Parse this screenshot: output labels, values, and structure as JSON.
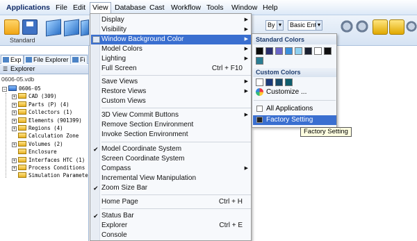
{
  "menubar": {
    "items": [
      "Applications",
      "File",
      "Edit",
      "View",
      "Database",
      "Cast",
      "Workflow",
      "Tools",
      "Window",
      "Help"
    ]
  },
  "toolbar": {
    "group_label": "Standard",
    "combo_by": "By",
    "combo_basic": "Basic Ent"
  },
  "left_panel": {
    "tabs": [
      "Exp",
      "File Explorer",
      "Fi"
    ],
    "title": "Explorer",
    "file_path": "0606-05.vdb",
    "tree": [
      {
        "label": "0606-05",
        "level": 0,
        "expander": "−"
      },
      {
        "label": "CAD (309)",
        "level": 1,
        "expander": "+"
      },
      {
        "label": "Parts (P) (4)",
        "level": 1,
        "expander": "+"
      },
      {
        "label": "Collectors (1)",
        "level": 1,
        "expander": "+"
      },
      {
        "label": "Elements (901399)",
        "level": 1,
        "expander": "+"
      },
      {
        "label": "Regions (4)",
        "level": 1,
        "expander": "+"
      },
      {
        "label": "Calculation Zone",
        "level": 1,
        "expander": ""
      },
      {
        "label": "Volumes (2)",
        "level": 1,
        "expander": "+"
      },
      {
        "label": "Enclosure",
        "level": 1,
        "expander": ""
      },
      {
        "label": "Interfaces HTC (1)",
        "level": 1,
        "expander": "+"
      },
      {
        "label": "Process Conditions",
        "level": 1,
        "expander": "+"
      },
      {
        "label": "Simulation Paramete",
        "level": 1,
        "expander": ""
      }
    ]
  },
  "view_menu": {
    "items": [
      {
        "label": "Display",
        "shortcut": "",
        "arrow": true,
        "check": false
      },
      {
        "label": "Visibility",
        "shortcut": "",
        "arrow": true,
        "check": false
      },
      {
        "label": "Window Background Color",
        "shortcut": "",
        "arrow": true,
        "check": false,
        "highlighted": true
      },
      {
        "label": "Model Colors",
        "shortcut": "",
        "arrow": true,
        "check": false
      },
      {
        "label": "Lighting",
        "shortcut": "",
        "arrow": true,
        "check": false
      },
      {
        "label": "Full Screen",
        "shortcut": "Ctrl + F10",
        "arrow": false,
        "check": false
      },
      {
        "label": "Save Views",
        "shortcut": "",
        "arrow": true,
        "check": false
      },
      {
        "label": "Restore Views",
        "shortcut": "",
        "arrow": true,
        "check": false
      },
      {
        "label": "Custom Views",
        "shortcut": "",
        "arrow": false,
        "check": false
      },
      {
        "label": "3D View Commit Buttons",
        "shortcut": "",
        "arrow": true,
        "check": false
      },
      {
        "label": "Remove Section Environment",
        "shortcut": "",
        "arrow": false,
        "check": false
      },
      {
        "label": "Invoke Section Environment",
        "shortcut": "",
        "arrow": false,
        "check": false
      },
      {
        "label": "Model Coordinate System",
        "shortcut": "",
        "arrow": false,
        "check": true
      },
      {
        "label": "Screen Coordinate System",
        "shortcut": "",
        "arrow": false,
        "check": false
      },
      {
        "label": "Compass",
        "shortcut": "",
        "arrow": true,
        "check": false
      },
      {
        "label": "Incremental View Manipulation",
        "shortcut": "",
        "arrow": false,
        "check": false
      },
      {
        "label": "Zoom Size Bar",
        "shortcut": "",
        "arrow": false,
        "check": true
      },
      {
        "label": "Home Page",
        "shortcut": "Ctrl + H",
        "arrow": false,
        "check": false
      },
      {
        "label": "Status Bar",
        "shortcut": "",
        "arrow": false,
        "check": true
      },
      {
        "label": "Explorer",
        "shortcut": "Ctrl + E",
        "arrow": false,
        "check": false
      },
      {
        "label": "Console",
        "shortcut": "",
        "arrow": false,
        "check": false
      }
    ]
  },
  "color_submenu": {
    "standard_header": "Standard Colors",
    "standard_colors": [
      "#0a0a0a",
      "#2a2f6e",
      "#6a66c8",
      "#3a8fdc",
      "#8fd0f0",
      "#1a2030",
      "#ffffff",
      "#0f0f10",
      "#2a7d93"
    ],
    "custom_header": "Custom Colors",
    "custom_colors": [
      "#ffffff",
      "#1a3a7a",
      "#164a6a",
      "#0e5e6e"
    ],
    "customize_label": "Customize ...",
    "all_applications_label": "All Applications",
    "factory_setting_label": "Factory Setting"
  },
  "tooltip": "Factory Setting",
  "colors": {
    "menu_highlight": "#3a6fd0",
    "menubar_bg": "#dce9f7"
  }
}
